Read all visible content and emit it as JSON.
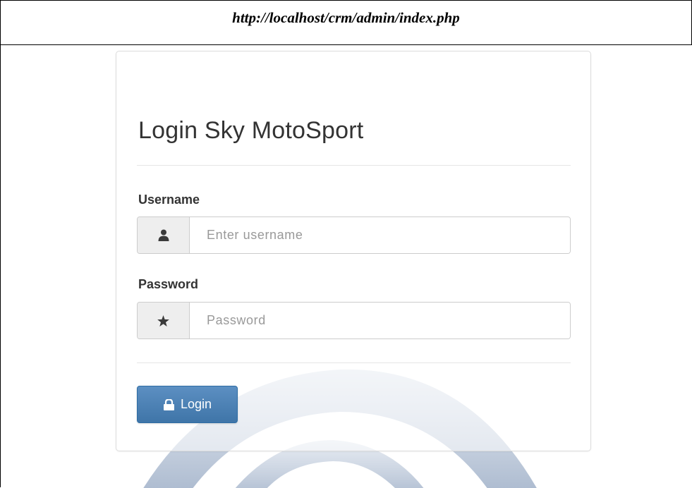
{
  "caption": {
    "url": "http://localhost/crm/admin/index.php"
  },
  "login": {
    "title": "Login Sky MotoSport",
    "username_label": "Username",
    "username_placeholder": "Enter username",
    "username_icon": "user-icon",
    "password_label": "Password",
    "password_placeholder": "Password",
    "password_icon": "star-icon",
    "submit_label": "Login",
    "submit_icon": "lock-icon"
  },
  "colors": {
    "button_blue": "#4a7fb5",
    "title_text": "#333333",
    "panel_border": "#dcdcdc",
    "addon_bg": "#eeeeee"
  }
}
